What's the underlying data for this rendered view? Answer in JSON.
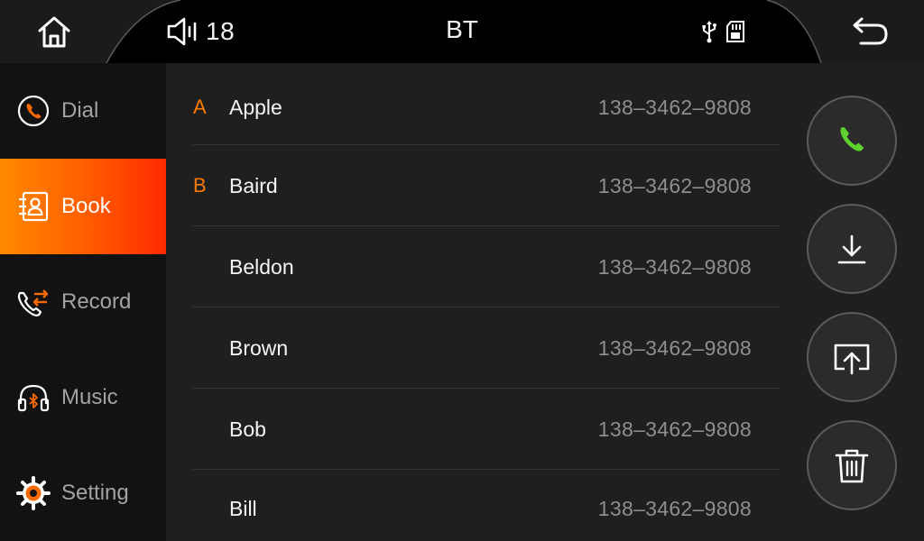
{
  "topbar": {
    "volume_icon": "speaker-icon",
    "volume_value": "18",
    "title": "BT",
    "status_icons": [
      "usb-icon",
      "sd-card-icon"
    ],
    "home_icon": "home-icon",
    "back_icon": "back-arrow-icon"
  },
  "sidebar": {
    "active_index": 1,
    "accent_color": "#ff6a00",
    "items": [
      {
        "label": "Dial",
        "icon": "phone-circle-icon"
      },
      {
        "label": "Book",
        "icon": "contacts-book-icon"
      },
      {
        "label": "Record",
        "icon": "call-record-icon"
      },
      {
        "label": "Music",
        "icon": "bluetooth-headphones-icon"
      },
      {
        "label": "Setting",
        "icon": "gear-icon"
      }
    ]
  },
  "contacts": [
    {
      "letter": "A",
      "name": "Apple",
      "phone": "138–3462–9808"
    },
    {
      "letter": "B",
      "name": "Baird",
      "phone": "138–3462–9808"
    },
    {
      "letter": "",
      "name": "Beldon",
      "phone": "138–3462–9808"
    },
    {
      "letter": "",
      "name": "Brown",
      "phone": "138–3462–9808"
    },
    {
      "letter": "",
      "name": "Bob",
      "phone": "138–3462–9808"
    },
    {
      "letter": "",
      "name": "Bill",
      "phone": "138–3462–9808"
    }
  ],
  "actions": [
    {
      "icon": "call-icon",
      "color": "#5fd12e"
    },
    {
      "icon": "download-icon",
      "color": "#ffffff"
    },
    {
      "icon": "upload-screen-icon",
      "color": "#ffffff"
    },
    {
      "icon": "trash-icon",
      "color": "#ffffff"
    }
  ]
}
